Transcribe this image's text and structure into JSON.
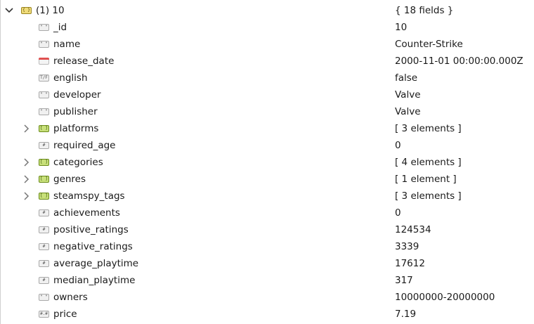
{
  "root": {
    "label": "(1) 10",
    "value": "{ 18 fields }",
    "type": "object"
  },
  "fields": [
    {
      "name": "_id",
      "value": "10",
      "type": "string"
    },
    {
      "name": "name",
      "value": "Counter-Strike",
      "type": "string"
    },
    {
      "name": "release_date",
      "value": "2000-11-01 00:00:00.000Z",
      "type": "date"
    },
    {
      "name": "english",
      "value": "false",
      "type": "bool"
    },
    {
      "name": "developer",
      "value": "Valve",
      "type": "string"
    },
    {
      "name": "publisher",
      "value": "Valve",
      "type": "string"
    },
    {
      "name": "platforms",
      "value": "[ 3 elements ]",
      "type": "array"
    },
    {
      "name": "required_age",
      "value": "0",
      "type": "int"
    },
    {
      "name": "categories",
      "value": "[ 4 elements ]",
      "type": "array"
    },
    {
      "name": "genres",
      "value": "[ 1 element ]",
      "type": "array"
    },
    {
      "name": "steamspy_tags",
      "value": "[ 3 elements ]",
      "type": "array"
    },
    {
      "name": "achievements",
      "value": "0",
      "type": "int"
    },
    {
      "name": "positive_ratings",
      "value": "124534",
      "type": "int"
    },
    {
      "name": "negative_ratings",
      "value": "3339",
      "type": "int"
    },
    {
      "name": "average_playtime",
      "value": "17612",
      "type": "int"
    },
    {
      "name": "median_playtime",
      "value": "317",
      "type": "int"
    },
    {
      "name": "owners",
      "value": "10000000-20000000",
      "type": "string"
    },
    {
      "name": "price",
      "value": "7.19",
      "type": "double"
    }
  ]
}
